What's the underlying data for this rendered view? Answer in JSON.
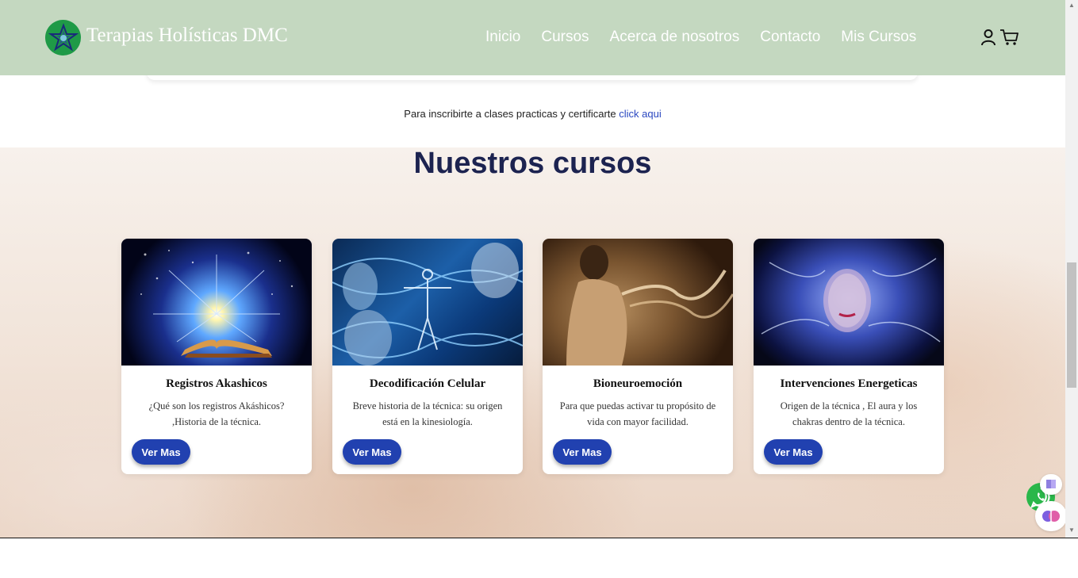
{
  "navbar": {
    "brand": "Terapias Holísticas DMC",
    "links": [
      "Inicio",
      "Cursos",
      "Acerca de nosotros",
      "Contacto",
      "Mis Cursos"
    ],
    "icons": [
      "user-icon",
      "cart-icon"
    ],
    "background": "#c4d8c0"
  },
  "enroll": {
    "text": "Para inscribirte a clases practicas y certificarte ",
    "link": "click aqui"
  },
  "section": {
    "title": "Nuestros cursos"
  },
  "courses": [
    {
      "title": "Registros Akashicos",
      "description": "¿Qué son los registros Akáshicos? ,Historia de la técnica.",
      "button": "Ver Mas"
    },
    {
      "title": "Decodificación Celular",
      "description": "Breve historia de la técnica: su origen está en la kinesiología.",
      "button": "Ver Mas"
    },
    {
      "title": "Bioneuroemoción",
      "description": "Para que puedas activar tu propósito de vida con mayor facilidad.",
      "button": "Ver Mas"
    },
    {
      "title": "Intervenciones Energeticas",
      "description": "Origen de la técnica , El aura y los chakras dentro de la técnica.",
      "button": "Ver Mas"
    }
  ],
  "floating": [
    "whatsapp-icon",
    "book-icon",
    "brain-icon"
  ],
  "colors": {
    "accent": "#2141b0",
    "title": "#1c2350",
    "link": "#2a47c0"
  }
}
